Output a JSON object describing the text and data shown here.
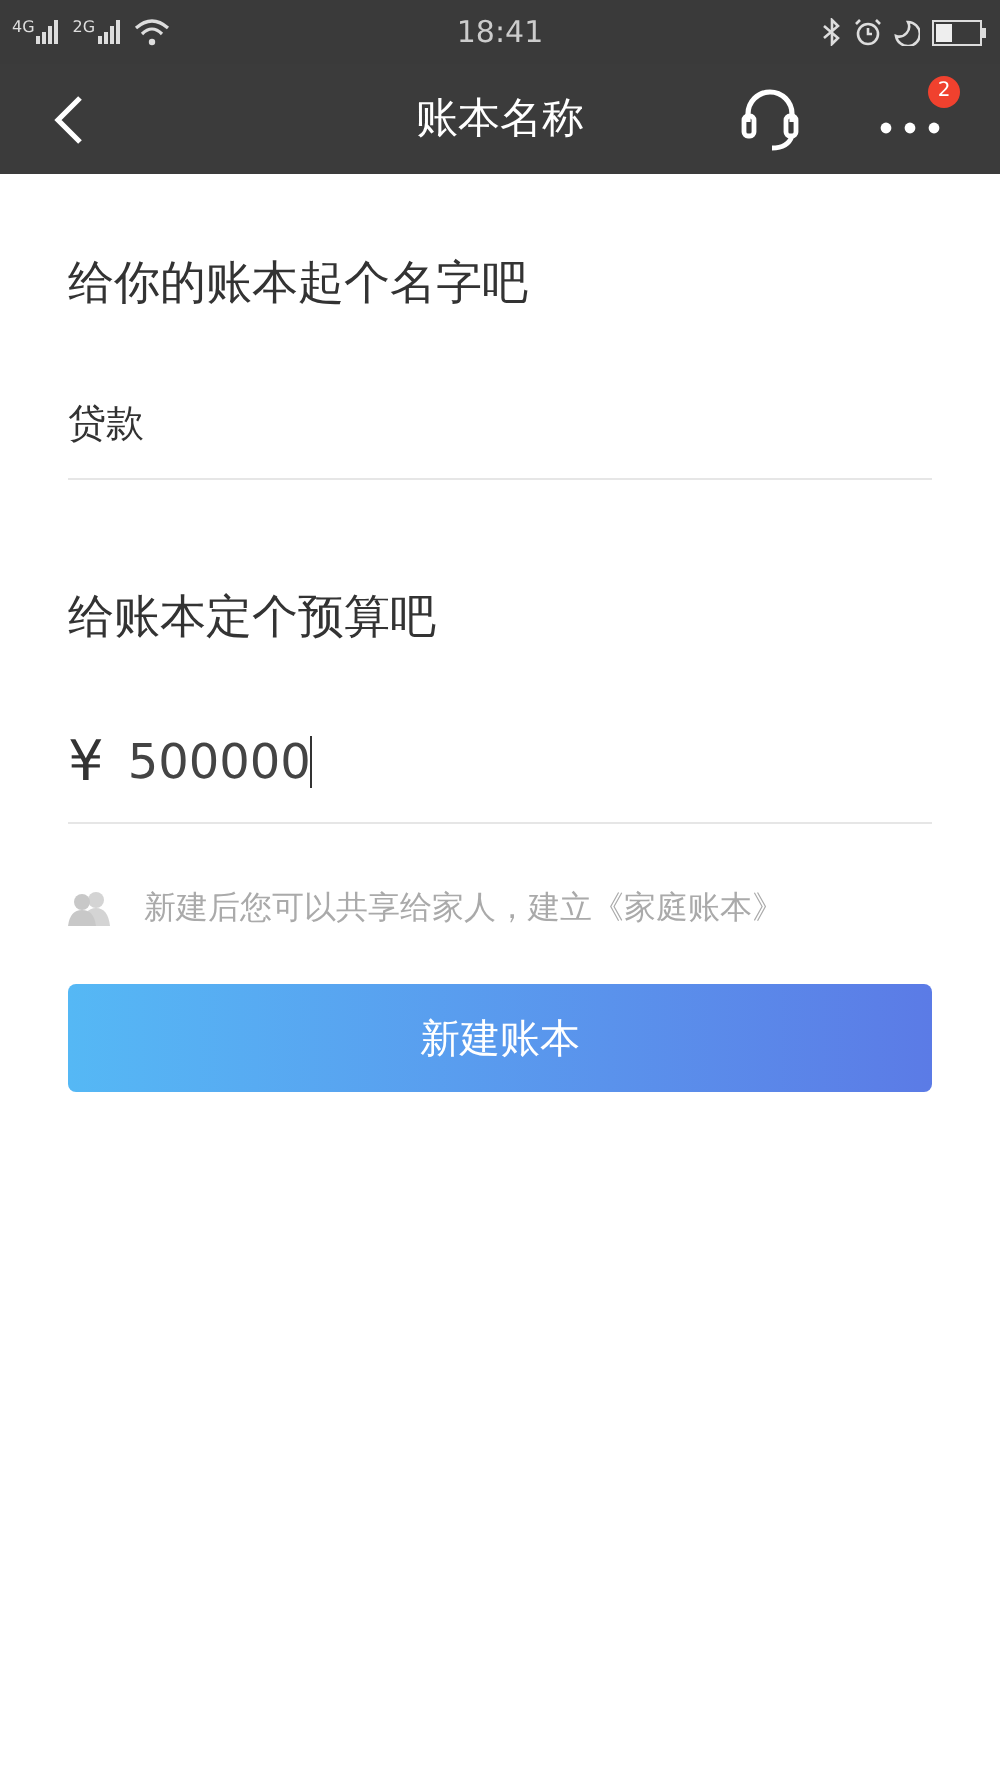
{
  "status_bar": {
    "networks": [
      "4G",
      "2G"
    ],
    "time": "18:41"
  },
  "header": {
    "title": "账本名称",
    "badge": "2"
  },
  "name_section": {
    "heading": "给你的账本起个名字吧",
    "value": "贷款"
  },
  "budget_section": {
    "heading": "给账本定个预算吧",
    "currency": "¥",
    "value": "500000",
    "focused": true
  },
  "hint": "新建后您可以共享给家人，建立《家庭账本》",
  "button": "新建账本"
}
